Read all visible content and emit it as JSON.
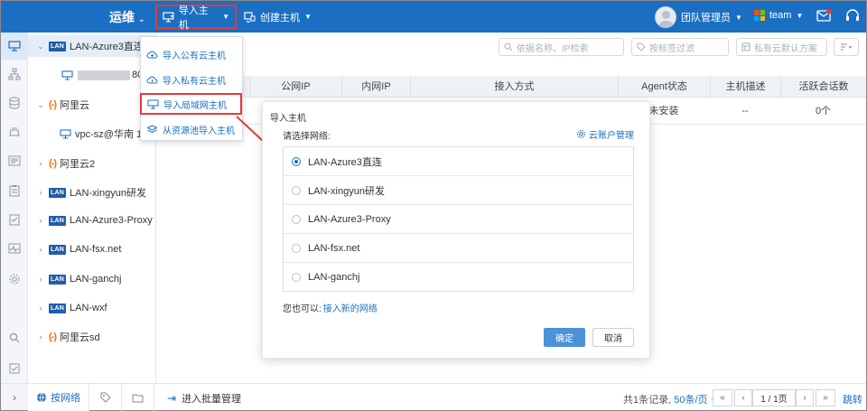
{
  "topbar": {
    "brand": "运维",
    "import_label": "导入主机",
    "create_label": "创建主机",
    "user_name": "团队管理员",
    "team_label": "team"
  },
  "tree": {
    "items": [
      {
        "label": "LAN-Azure3直连",
        "type": "lan",
        "expanded": true
      },
      {
        "label": "80.*",
        "type": "host"
      },
      {
        "label": "阿里云",
        "type": "aliyun",
        "expanded": true
      },
      {
        "label": "vpc-sz@华南 1",
        "type": "vpc"
      },
      {
        "label": "阿里云2",
        "type": "aliyun"
      },
      {
        "label": "LAN-xingyun研发",
        "type": "lan"
      },
      {
        "label": "LAN-Azure3-Proxy",
        "type": "lan"
      },
      {
        "label": "LAN-fsx.net",
        "type": "lan"
      },
      {
        "label": "LAN-ganchj",
        "type": "lan"
      },
      {
        "label": "LAN-wxf",
        "type": "lan"
      },
      {
        "label": "阿里云sd",
        "type": "aliyun"
      }
    ],
    "bottom_tab": "按网络"
  },
  "filters": {
    "search_placeholder": "依据名称、IP检索",
    "tag_placeholder": "按标签过滤",
    "plan_placeholder": "私有云默认方案"
  },
  "table": {
    "columns": [
      "公网IP",
      "内网IP",
      "接入方式",
      "Agent状态",
      "主机描述",
      "活跃会话数"
    ],
    "row": {
      "agent": "未安装",
      "desc": "--",
      "sessions": "0个"
    }
  },
  "dropdown": {
    "items": [
      "导入公有云主机",
      "导入私有云主机",
      "导入局域网主机",
      "从资源池导入主机"
    ]
  },
  "modal": {
    "title": "导入主机",
    "label": "请选择网络:",
    "cloud_link": "云账户管理",
    "options": [
      "LAN-Azure3直连",
      "LAN-xingyun研发",
      "LAN-Azure3-Proxy",
      "LAN-fsx.net",
      "LAN-ganchj"
    ],
    "selected_index": 0,
    "also_text": "您也可以:",
    "also_link": "接入新的网络",
    "ok": "确定",
    "cancel": "取消"
  },
  "footer": {
    "batch": "进入批量管理",
    "records": "共1条记录,",
    "per_page": "50条/页",
    "page": "1 / 1页",
    "jump": "跳转"
  },
  "colors": {
    "brand": "#1b6fc2",
    "highlight": "#e23a3a",
    "aliyun": "#ff6a00",
    "lan": "#1f5ea8"
  }
}
